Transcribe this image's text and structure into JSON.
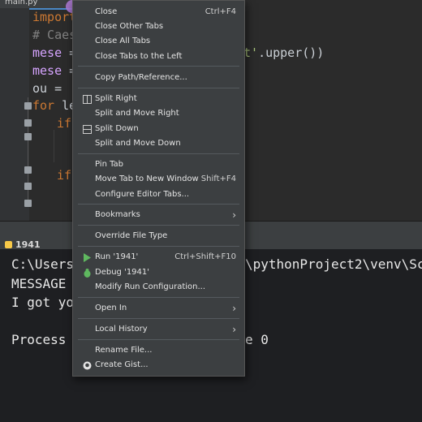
{
  "editor": {
    "tab_label": "main.py",
    "lines": [
      {
        "kw": "import",
        "rest": ""
      },
      {
        "cm": "# Caesa"
      },
      {
        "purple": "mese",
        "rest": " = "
      },
      {
        "purple": "mese",
        "rest": " = "
      },
      {
        "rest": "ou = ''"
      },
      {
        "kw": "for",
        "rest": " let"
      },
      {
        "kw": "if",
        "rest": ""
      },
      {
        "kw": "if",
        "rest": ""
      }
    ],
    "right_fragment": "t'.upper())"
  },
  "run_panel": {
    "tab_label": "1941",
    "terminal": {
      "line1_left": "C:\\Users",
      "line1_right": "\\pythonProject2\\venv\\Sc",
      "line2": "MESSAGE",
      "line3": "I got yo",
      "line4_left": "Process",
      "line4_right": "e 0"
    }
  },
  "menu": {
    "items": [
      {
        "label": "Close",
        "shortcut": "Ctrl+F4"
      },
      {
        "label": "Close Other Tabs"
      },
      {
        "label": "Close All Tabs"
      },
      {
        "label": "Close Tabs to the Left"
      },
      {
        "label": "Copy Path/Reference..."
      },
      {
        "label": "Split Right"
      },
      {
        "label": "Split and Move Right"
      },
      {
        "label": "Split Down"
      },
      {
        "label": "Split and Move Down"
      },
      {
        "label": "Pin Tab"
      },
      {
        "label": "Move Tab to New Window",
        "shortcut": "Shift+F4"
      },
      {
        "label": "Configure Editor Tabs..."
      },
      {
        "label": "Bookmarks",
        "arrow": "›"
      },
      {
        "label": "Override File Type"
      },
      {
        "label": "Run '1941'",
        "shortcut": "Ctrl+Shift+F10"
      },
      {
        "label": "Debug '1941'"
      },
      {
        "label": "Modify Run Configuration..."
      },
      {
        "label": "Open In",
        "arrow": "›"
      },
      {
        "label": "Local History",
        "arrow": "›"
      },
      {
        "label": "Rename File..."
      },
      {
        "label": "Create Gist..."
      }
    ]
  },
  "colors": {
    "run_icon": "#5fb85f",
    "debug_icon": "#5fb85f",
    "python_icon": "#f7c948",
    "menu_bg": "#3c3f41"
  }
}
